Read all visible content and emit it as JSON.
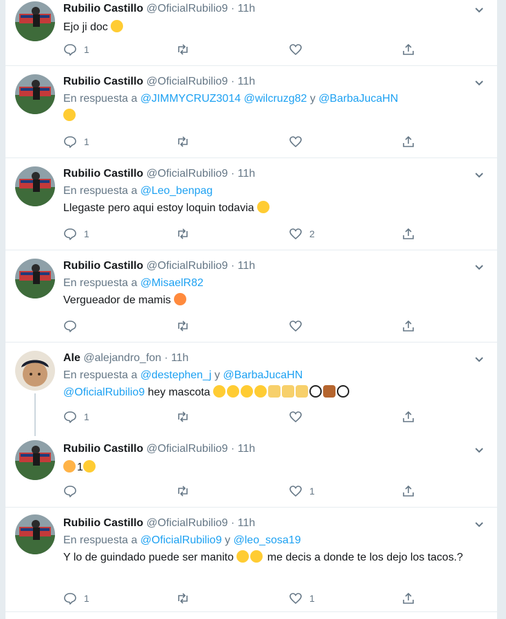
{
  "tweets": [
    {
      "name": "Rubilio Castillo",
      "handle": "@OficialRubilio9",
      "time": "11h",
      "reply_prefix": "",
      "reply_mentions": "",
      "reply_join": "",
      "reply_mentions2": "",
      "text": "Ejo ji doc",
      "emoji": [
        "laughing"
      ],
      "replies": "1",
      "retweets": "",
      "likes": ""
    },
    {
      "name": "Rubilio Castillo",
      "handle": "@OficialRubilio9",
      "time": "11h",
      "reply_prefix": "En respuesta a",
      "reply_mentions": "@JIMMYCRUZ3014 @wilcruzg82",
      "reply_join": "y",
      "reply_mentions2": "@BarbaJucaHN",
      "text": "",
      "emoji": [
        "laughing"
      ],
      "replies": "1",
      "retweets": "",
      "likes": ""
    },
    {
      "name": "Rubilio Castillo",
      "handle": "@OficialRubilio9",
      "time": "11h",
      "reply_prefix": "En respuesta a",
      "reply_mentions": "@Leo_benpag",
      "reply_join": "",
      "reply_mentions2": "",
      "text": "Llegaste pero aqui estoy loquin todavia",
      "emoji": [
        "laughing"
      ],
      "replies": "1",
      "retweets": "",
      "likes": "2"
    },
    {
      "name": "Rubilio Castillo",
      "handle": "@OficialRubilio9",
      "time": "11h",
      "reply_prefix": "En respuesta a",
      "reply_mentions": "@MisaelR82",
      "reply_join": "",
      "reply_mentions2": "",
      "text": "Vergueador de mamis",
      "emoji": [
        "tongue"
      ],
      "replies": "",
      "retweets": "",
      "likes": ""
    },
    {
      "name": "Ale",
      "handle": "@alejandro_fon",
      "time": "11h",
      "reply_prefix": "En respuesta a",
      "reply_mentions": "@destephen_j",
      "reply_join": "y",
      "reply_mentions2": "@BarbaJucaHN",
      "text_mention": "@OficialRubilio9",
      "text": "hey mascota",
      "emoji": [
        "laughing",
        "laughing",
        "laughing",
        "laughing",
        "victory",
        "victory",
        "victory",
        "soccer",
        "squirrel",
        "soccer"
      ],
      "replies": "1",
      "retweets": "",
      "likes": ""
    },
    {
      "name": "Rubilio Castillo",
      "handle": "@OficialRubilio9",
      "time": "11h",
      "reply_prefix": "",
      "reply_mentions": "",
      "reply_join": "",
      "reply_mentions2": "",
      "text_pre_emoji": [
        "hearts-face"
      ],
      "text": "1",
      "emoji": [
        "kiss"
      ],
      "replies": "",
      "retweets": "",
      "likes": "1"
    },
    {
      "name": "Rubilio Castillo",
      "handle": "@OficialRubilio9",
      "time": "11h",
      "reply_prefix": "En respuesta a",
      "reply_mentions": "@OficialRubilio9",
      "reply_join": "y",
      "reply_mentions2": "@leo_sosa19",
      "text": "Y lo de guindado puede ser manito",
      "text_after": "me decis a donde te los dejo los tacos.?",
      "emoji": [
        "thinking",
        "rofl"
      ],
      "replies": "1",
      "retweets": "",
      "likes": "1"
    }
  ],
  "colors": {
    "link": "#1da1f2",
    "muted": "#657786",
    "divider": "#e6ecf0"
  },
  "icons": [
    "reply-icon",
    "retweet-icon",
    "like-icon",
    "share-icon",
    "chevron-down-icon"
  ]
}
